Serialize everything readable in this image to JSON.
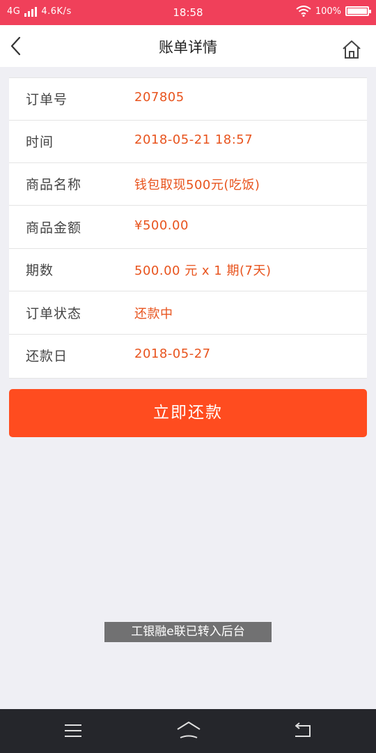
{
  "status_bar": {
    "network": "4G",
    "speed": "4.6K/s",
    "time": "18:58",
    "battery": "100%",
    "battery_level": 1.0
  },
  "header": {
    "title": "账单详情",
    "back_icon": "chevron-left-icon",
    "home_icon": "home-icon"
  },
  "details": [
    {
      "label": "订单号",
      "value": "207805"
    },
    {
      "label": "时间",
      "value": "2018-05-21 18:57"
    },
    {
      "label": "商品名称",
      "value": "钱包取现500元(吃饭)"
    },
    {
      "label": "商品金额",
      "value": "¥500.00"
    },
    {
      "label": "期数",
      "value": "500.00 元 x 1 期(7天)"
    },
    {
      "label": "订单状态",
      "value": "还款中"
    },
    {
      "label": "还款日",
      "value": "2018-05-27"
    }
  ],
  "pay_button": {
    "label": "立即还款"
  },
  "toast": {
    "text": "工银融e联已转入后台"
  },
  "colors": {
    "status_bar": "#f0405a",
    "accent": "#ff4c1f",
    "value_text": "#e8541e",
    "background": "#efeff4",
    "system_nav": "#25262b"
  }
}
